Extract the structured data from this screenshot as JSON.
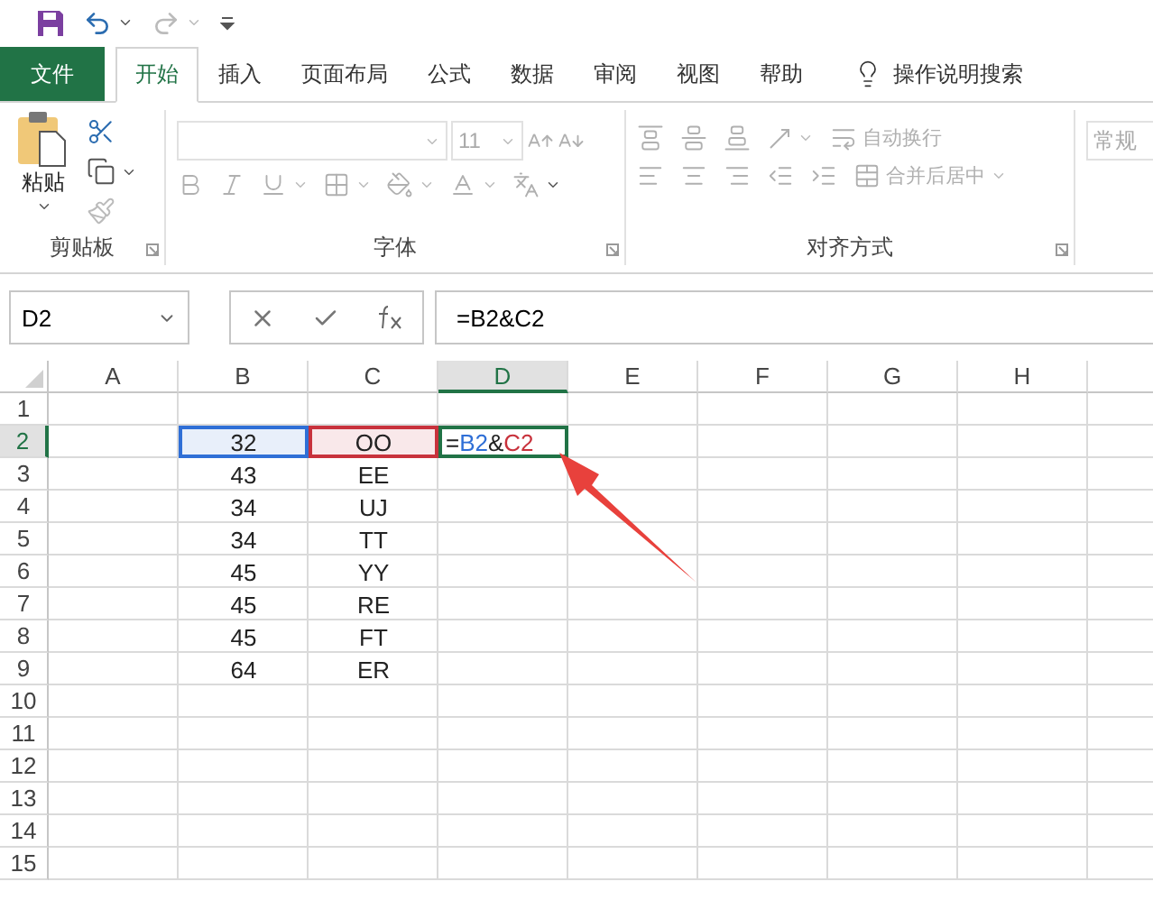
{
  "quick_access": {
    "items": [
      {
        "kind": "save"
      },
      {
        "kind": "undo"
      },
      {
        "kind": "redo"
      },
      {
        "kind": "customize"
      }
    ]
  },
  "tabs": [
    {
      "label": "文件",
      "kind": "file",
      "selected": false
    },
    {
      "label": "开始",
      "kind": "tab",
      "selected": true
    },
    {
      "label": "插入",
      "kind": "tab",
      "selected": false
    },
    {
      "label": "页面布局",
      "kind": "tab",
      "selected": false
    },
    {
      "label": "公式",
      "kind": "tab",
      "selected": false
    },
    {
      "label": "数据",
      "kind": "tab",
      "selected": false
    },
    {
      "label": "审阅",
      "kind": "tab",
      "selected": false
    },
    {
      "label": "视图",
      "kind": "tab",
      "selected": false
    },
    {
      "label": "帮助",
      "kind": "tab",
      "selected": false
    },
    {
      "label": "操作说明搜索",
      "kind": "search",
      "selected": false
    }
  ],
  "ribbon": {
    "clipboard": {
      "paste_label": "粘贴",
      "group_label": "剪贴板"
    },
    "font": {
      "font_size": "11",
      "group_label": "字体"
    },
    "alignment": {
      "wrap_label": "自动换行",
      "merge_label": "合并后居中",
      "group_label": "对齐方式"
    },
    "number": {
      "format": "常规"
    }
  },
  "formula_bar": {
    "name_box": "D2",
    "formula": "=B2&C2"
  },
  "sheet": {
    "columns": [
      {
        "label": "A",
        "selected": false
      },
      {
        "label": "B",
        "selected": false
      },
      {
        "label": "C",
        "selected": false
      },
      {
        "label": "D",
        "selected": true
      },
      {
        "label": "E",
        "selected": false
      },
      {
        "label": "F",
        "selected": false
      },
      {
        "label": "G",
        "selected": false
      },
      {
        "label": "H",
        "selected": false
      }
    ],
    "rows": [
      {
        "label": "1",
        "selected": false
      },
      {
        "label": "2",
        "selected": true,
        "cells": [
          null,
          {
            "text": "32",
            "color": "#2f6fd6"
          },
          {
            "text": "OO",
            "color": "#c8323c"
          },
          {
            "parts": [
              {
                "text": "=",
                "color": "#222222"
              },
              {
                "text": "B2",
                "color": "#2f6fd6"
              },
              {
                "text": "&",
                "color": "#222222"
              },
              {
                "text": "C2",
                "color": "#c8323c"
              }
            ]
          }
        ]
      },
      {
        "label": "3",
        "selected": false,
        "cells": [
          null,
          {
            "text": "43"
          },
          {
            "text": "EE"
          }
        ]
      },
      {
        "label": "4",
        "selected": false,
        "cells": [
          null,
          {
            "text": "34"
          },
          {
            "text": "UJ"
          }
        ]
      },
      {
        "label": "5",
        "selected": false,
        "cells": [
          null,
          {
            "text": "34"
          },
          {
            "text": "TT"
          }
        ]
      },
      {
        "label": "6",
        "selected": false,
        "cells": [
          null,
          {
            "text": "45"
          },
          {
            "text": "YY"
          }
        ]
      },
      {
        "label": "7",
        "selected": false,
        "cells": [
          null,
          {
            "text": "45"
          },
          {
            "text": "RE"
          }
        ]
      },
      {
        "label": "8",
        "selected": false,
        "cells": [
          null,
          {
            "text": "45"
          },
          {
            "text": "FT"
          }
        ]
      },
      {
        "label": "9",
        "selected": false,
        "cells": [
          null,
          {
            "text": "64"
          },
          {
            "text": "ER"
          }
        ]
      },
      {
        "label": "10",
        "selected": false
      },
      {
        "label": "11",
        "selected": false
      },
      {
        "label": "12",
        "selected": false
      },
      {
        "label": "13",
        "selected": false
      },
      {
        "label": "14",
        "selected": false
      },
      {
        "label": "15",
        "selected": false
      }
    ]
  }
}
